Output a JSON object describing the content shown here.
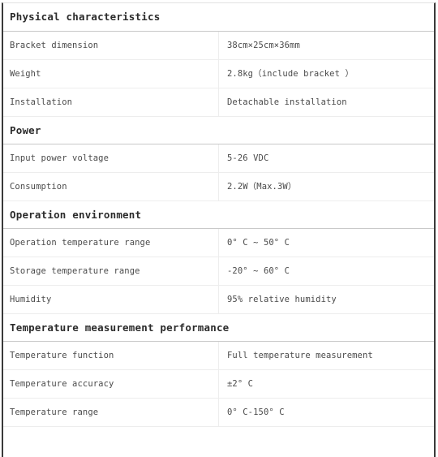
{
  "document": {
    "type": "specification-table",
    "sections": [
      {
        "title": "Physical characteristics",
        "rows": [
          {
            "label": "Bracket dimension",
            "value": "38cm×25cm×36mm"
          },
          {
            "label": "Weight",
            "value": "2.8kg（include bracket ）"
          },
          {
            "label": "Installation",
            "value": "Detachable installation"
          }
        ]
      },
      {
        "title": "Power",
        "rows": [
          {
            "label": "Input power voltage",
            "value": "5-26 VDC"
          },
          {
            "label": "Consumption",
            "value": "2.2W（Max.3W）"
          }
        ]
      },
      {
        "title": "Operation environment",
        "rows": [
          {
            "label": "Operation temperature range",
            "value": "0° C ~ 50° C"
          },
          {
            "label": "Storage temperature range",
            "value": "-20° ~ 60° C"
          },
          {
            "label": "Humidity",
            "value": "95% relative humidity"
          }
        ]
      },
      {
        "title": "Temperature measurement performance",
        "rows": [
          {
            "label": "Temperature function",
            "value": "Full temperature measurement"
          },
          {
            "label": "Temperature accuracy",
            "value": "±2° C"
          },
          {
            "label": "Temperature range",
            "value": "0° C-150° C"
          }
        ]
      }
    ]
  },
  "colors": {
    "frame_border": "#3a3a3a",
    "section_rule": "#c9c9c9",
    "row_rule": "#ededed",
    "heading_text": "#2b2b2b",
    "body_text": "#4a4a4a",
    "background": "#ffffff"
  }
}
